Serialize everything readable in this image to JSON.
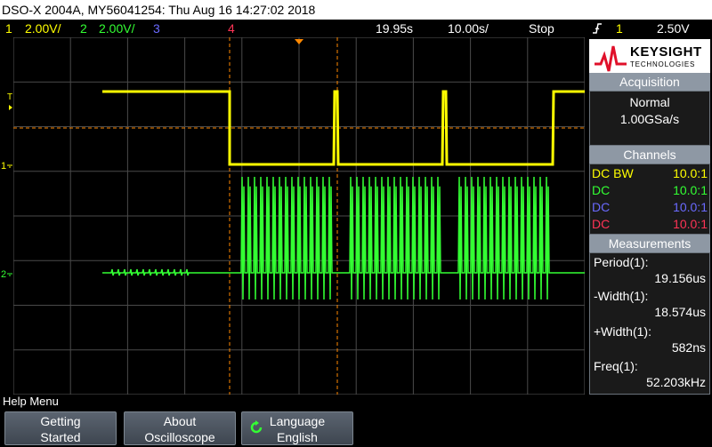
{
  "title_bar": {
    "text": "DSO-X 2004A, MY56041254: Thu Aug 16 14:27:02 2018"
  },
  "status_bar": {
    "ch1_num": "1",
    "ch1_scale": "2.00V/",
    "ch2_num": "2",
    "ch2_scale": "2.00V/",
    "ch3_num": "3",
    "ch4_num": "4",
    "time_delay": "19.95s",
    "time_scale": "10.00s/",
    "run_state": "Stop",
    "trigger_icon": "rising-edge-icon",
    "trigger_channel": "1",
    "trigger_level": "2.50V"
  },
  "brand": {
    "name": "KEYSIGHT",
    "subtitle": "TECHNOLOGIES"
  },
  "acquisition": {
    "header": "Acquisition",
    "mode": "Normal",
    "rate": "1.00GSa/s"
  },
  "channels": {
    "header": "Channels",
    "rows": [
      {
        "coupling": "DC BW",
        "probe": "10.0:1"
      },
      {
        "coupling": "DC",
        "probe": "10.0:1"
      },
      {
        "coupling": "DC",
        "probe": "10.0:1"
      },
      {
        "coupling": "DC",
        "probe": "10.0:1"
      }
    ]
  },
  "measurements": {
    "header": "Measurements",
    "items": [
      {
        "label": "Period(1):",
        "value": "19.156us"
      },
      {
        "label": "-Width(1):",
        "value": "18.574us"
      },
      {
        "label": "+Width(1):",
        "value": "582ns"
      },
      {
        "label": "Freq(1):",
        "value": "52.203kHz"
      }
    ]
  },
  "help": {
    "label": "Help Menu"
  },
  "softkeys": [
    {
      "line1": "Getting",
      "line2": "Started"
    },
    {
      "line1": "About",
      "line2": "Oscilloscope"
    },
    {
      "line1": "Language",
      "line2": "English"
    }
  ],
  "colors": {
    "ch1": "#ffff00",
    "ch2": "#33ff33",
    "ch3": "#6a6aff",
    "ch4": "#ff3355",
    "grid": "#5a5a5a",
    "cursor": "#ff8800",
    "panel_header": "#8e98a4"
  }
}
